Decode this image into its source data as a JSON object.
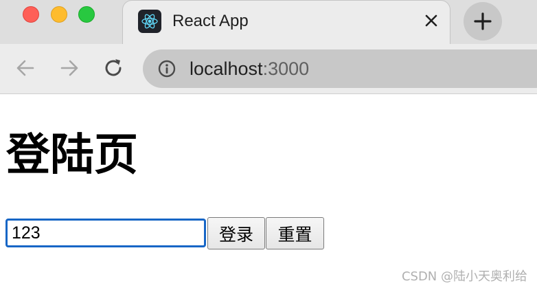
{
  "window": {
    "traffic_lights": [
      "close",
      "minimize",
      "zoom"
    ]
  },
  "tab": {
    "title": "React App",
    "favicon": "react-logo-icon",
    "close_icon": "close-icon"
  },
  "new_tab": {
    "icon": "plus-icon"
  },
  "toolbar": {
    "back_icon": "arrow-left-icon",
    "forward_icon": "arrow-right-icon",
    "reload_icon": "reload-icon",
    "site_info_icon": "info-icon",
    "url_host": "localhost",
    "url_port": ":3000"
  },
  "page": {
    "heading": "登陆页",
    "input_value": "123",
    "login_button": "登录",
    "reset_button": "重置"
  },
  "watermark": "CSDN @陆小天奥利给",
  "colors": {
    "input_focus_border": "#1766c6",
    "tabbar_bg": "#dedede",
    "omnibox_bg": "#c8c8c8"
  }
}
